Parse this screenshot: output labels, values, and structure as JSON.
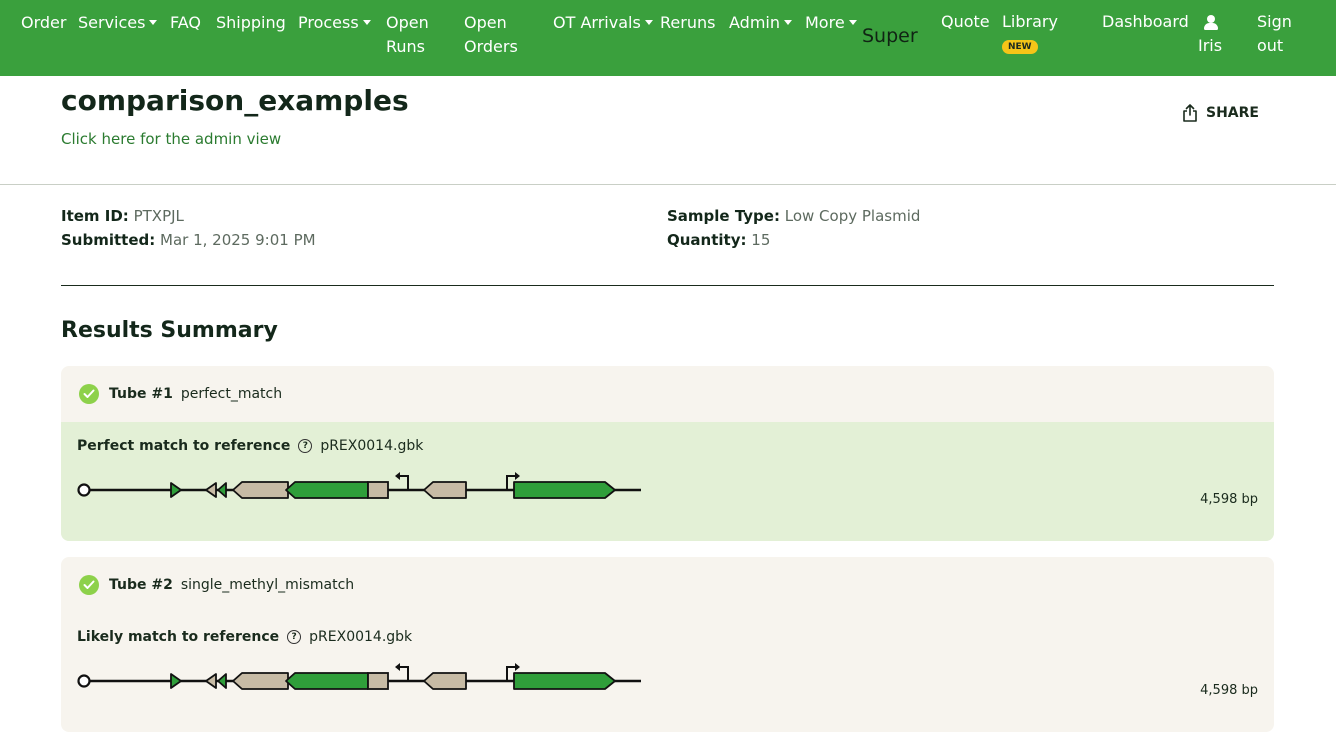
{
  "nav": {
    "order": "Order",
    "services": "Services",
    "faq": "FAQ",
    "shipping": "Shipping",
    "process": "Process",
    "open_runs_1": "Open",
    "open_runs_2": "Runs",
    "open_orders_1": "Open",
    "open_orders_2": "Orders",
    "ot_arrivals": "OT Arrivals",
    "reruns": "Reruns",
    "admin": "Admin",
    "more": "More",
    "super": "Super",
    "quote": "Quote",
    "library": "Library",
    "library_badge": "NEW",
    "dashboard": "Dashboard",
    "user": "Iris",
    "sign_out_1": "Sign",
    "sign_out_2": "out"
  },
  "header": {
    "title": "comparison_examples",
    "admin_link": "Click here for the admin view",
    "share": "SHARE"
  },
  "meta": {
    "item_id_label": "Item ID:",
    "item_id": "PTXPJL",
    "submitted_label": "Submitted:",
    "submitted": "Mar 1, 2025 9:01 PM",
    "sample_type_label": "Sample Type:",
    "sample_type": "Low Copy Plasmid",
    "quantity_label": "Quantity:",
    "quantity": "15"
  },
  "results": {
    "title": "Results Summary",
    "tubes": [
      {
        "tube_label": "Tube #1",
        "name": "perfect_match",
        "status": "Perfect match to reference",
        "reference": "pREX0014.gbk",
        "length": "4,598 bp",
        "highlight": "#e3f0d6"
      },
      {
        "tube_label": "Tube #2",
        "name": "single_methyl_mismatch",
        "status": "Likely match to reference",
        "reference": "pREX0014.gbk",
        "length": "4,598 bp",
        "highlight": "#f7f4ee"
      }
    ]
  },
  "colors": {
    "nav_bg": "#3aa03d",
    "feature_green": "#2f9e3a",
    "feature_tan": "#c7bba5",
    "check_green": "#8dd14a"
  }
}
